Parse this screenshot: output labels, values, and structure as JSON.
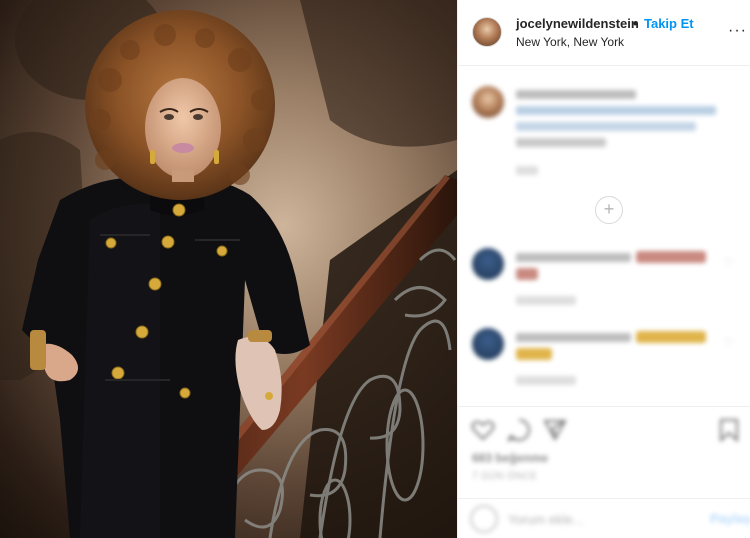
{
  "post": {
    "username": "jocelynewildenstein",
    "dot": "•",
    "follow_label": "Takip Et",
    "location": "New York, New York",
    "more_label": "···"
  },
  "comments": {
    "load_more_symbol": "+"
  },
  "actions": {
    "likes": "683 beğenme",
    "time": "7 GÜN ÖNCE"
  },
  "add_comment": {
    "placeholder": "Yorum ekle...",
    "post_label": "Paylaş"
  },
  "colors": {
    "follow": "#0095f6",
    "post_disabled": "#b8dafc",
    "border": "#efefef"
  },
  "icons": [
    "heart-icon",
    "comment-icon",
    "share-icon",
    "bookmark-icon",
    "more-icon",
    "emoji-icon",
    "plus-circle-icon"
  ]
}
